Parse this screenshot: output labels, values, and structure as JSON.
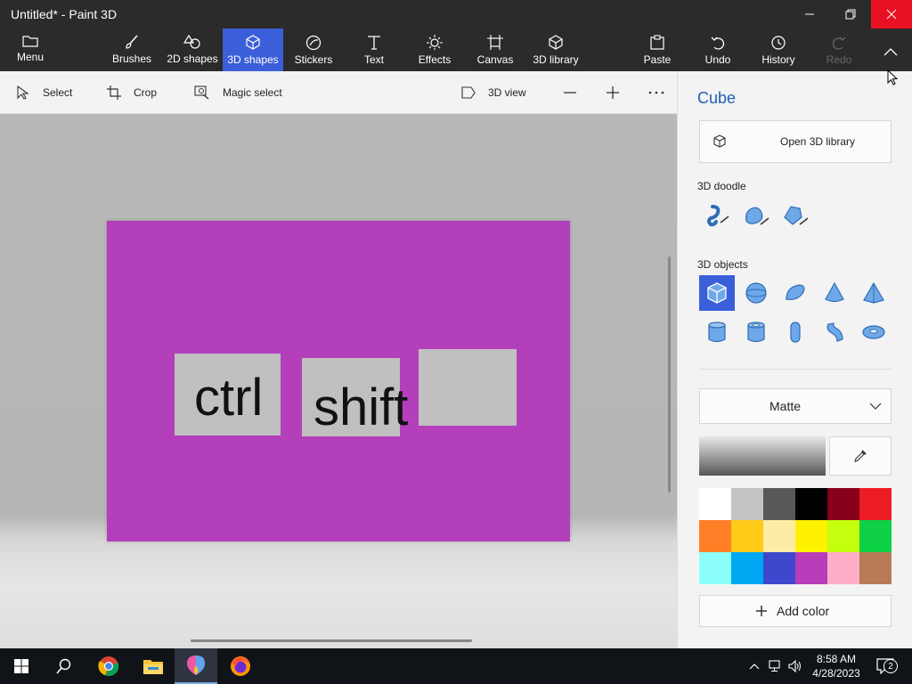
{
  "window": {
    "title": "Untitled* - Paint 3D"
  },
  "toolbar": {
    "menu": "Menu",
    "tools": [
      "Brushes",
      "2D shapes",
      "3D shapes",
      "Stickers",
      "Text",
      "Effects",
      "Canvas",
      "3D library"
    ],
    "paste": "Paste",
    "undo": "Undo",
    "history": "History",
    "redo": "Redo",
    "active_tool": "3D shapes"
  },
  "subtoolbar": {
    "select": "Select",
    "crop": "Crop",
    "magic_select": "Magic select",
    "view_3d": "3D view"
  },
  "canvas": {
    "color": "#b43fbb",
    "keys": [
      "ctrl",
      "shift",
      ""
    ]
  },
  "panel": {
    "title": "Cube",
    "open_library": "Open 3D library",
    "doodle_label": "3D doodle",
    "objects_label": "3D objects",
    "selected_object": "cube",
    "material": "Matte",
    "add_color": "Add color",
    "palette": [
      "#ffffff",
      "#c3c3c3",
      "#585858",
      "#000000",
      "#88001b",
      "#ec1c24",
      "#ff7f27",
      "#ffca18",
      "#fdeca6",
      "#fff200",
      "#c4ff0e",
      "#0ed145",
      "#8cfffb",
      "#00a8f3",
      "#3f48cc",
      "#b83dba",
      "#ffaec8",
      "#b97a56"
    ]
  },
  "taskbar": {
    "time": "8:58 AM",
    "date": "4/28/2023",
    "notifications": "2"
  }
}
